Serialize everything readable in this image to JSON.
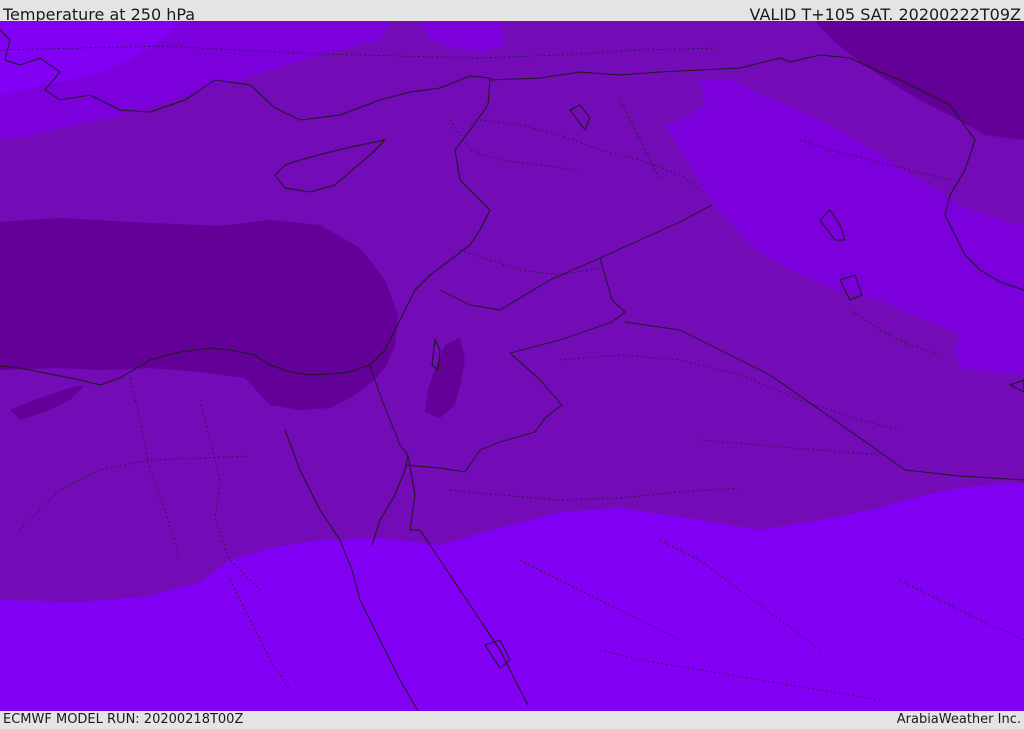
{
  "header": {
    "title": "Temperature at 250 hPa",
    "valid_time": "VALID T+105 SAT. 20200222T09Z"
  },
  "footer": {
    "model_run": "ECMWF MODEL RUN: 20200218T00Z",
    "credit": "ArabiaWeather Inc."
  },
  "map": {
    "fill_colors": {
      "light": "#7b00dc",
      "medium": "#730bb6",
      "dark": "#630097",
      "brightest": "#8200f3"
    },
    "line_color": "#1a1a1a"
  }
}
